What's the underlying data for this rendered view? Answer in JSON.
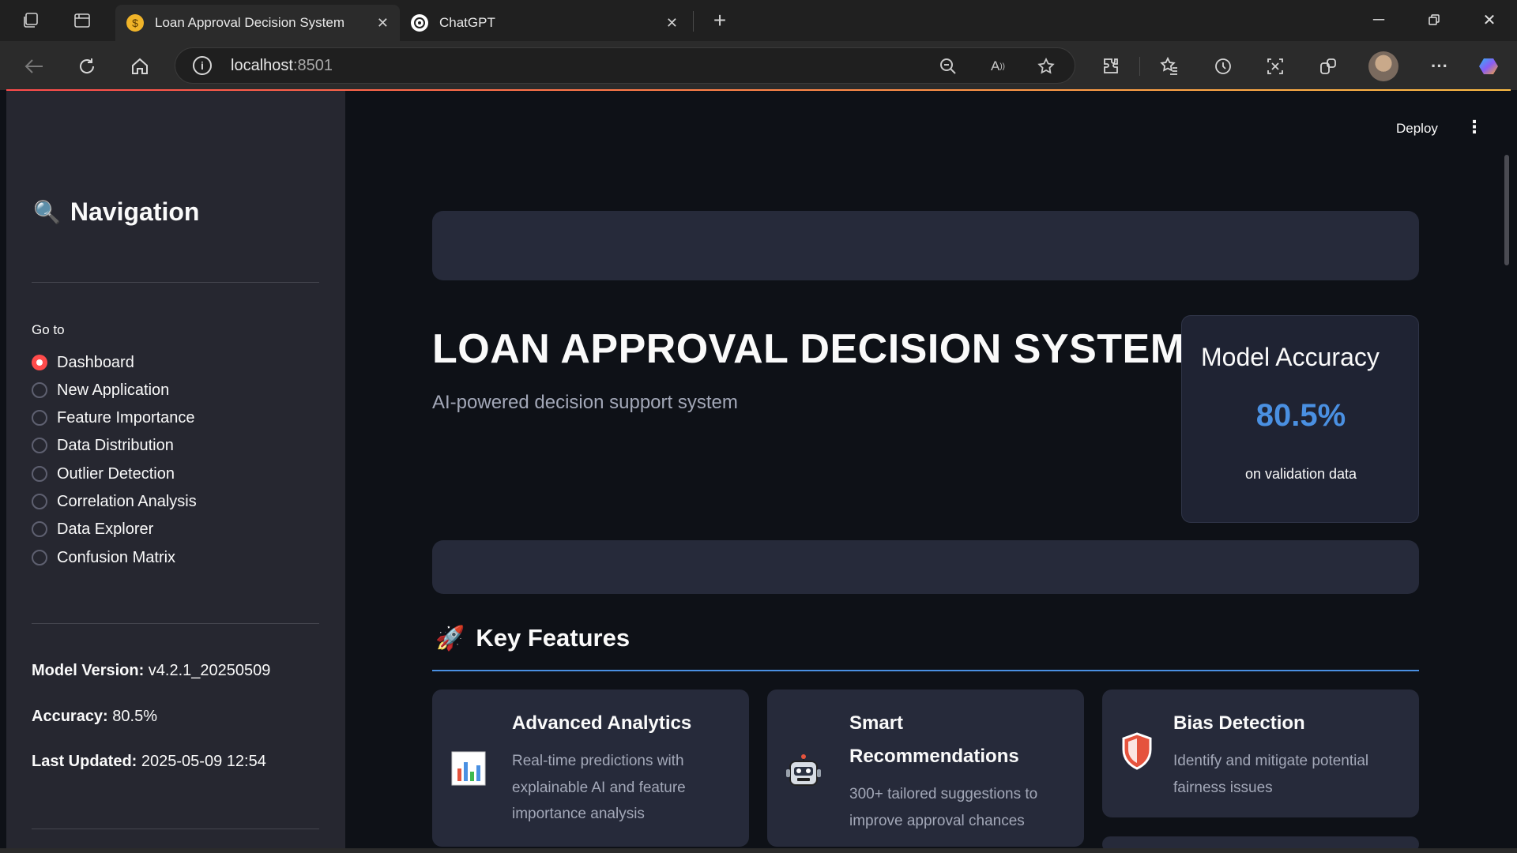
{
  "browser": {
    "tabs": [
      {
        "title": "Loan Approval Decision System",
        "favicon": "money-bag-icon",
        "active": true
      },
      {
        "title": "ChatGPT",
        "favicon": "chatgpt-icon",
        "active": false
      }
    ],
    "address": {
      "host": "localhost",
      "port": ":8501"
    }
  },
  "sidebar": {
    "title_icon": "🔍",
    "title": "Navigation",
    "goto_label": "Go to",
    "items": [
      {
        "label": "Dashboard",
        "selected": true
      },
      {
        "label": "New Application",
        "selected": false
      },
      {
        "label": "Feature Importance",
        "selected": false
      },
      {
        "label": "Data Distribution",
        "selected": false
      },
      {
        "label": "Outlier Detection",
        "selected": false
      },
      {
        "label": "Correlation Analysis",
        "selected": false
      },
      {
        "label": "Data Explorer",
        "selected": false
      },
      {
        "label": "Confusion Matrix",
        "selected": false
      }
    ],
    "meta": {
      "version_label": "Model Version:",
      "version_value": " v4.2.1_20250509",
      "accuracy_label": "Accuracy:",
      "accuracy_value": " 80.5%",
      "updated_label": "Last Updated:",
      "updated_value": " 2025-05-09 12:54"
    }
  },
  "header": {
    "deploy_label": "Deploy",
    "menu_icon": "⋮"
  },
  "hero": {
    "title": "LOAN APPROVAL DECISION SYSTEM",
    "subtitle": "AI-powered decision support system"
  },
  "accuracy_card": {
    "title": "Model Accuracy",
    "value": "80.5%",
    "caption": "on validation data"
  },
  "key_features": {
    "icon": "🚀",
    "title": "Key Features",
    "cards": [
      {
        "icon": "📊",
        "title_lines": [
          "Advanced Analytics"
        ],
        "desc_lines": [
          "Real-time predictions with",
          "explainable AI and feature",
          "importance analysis"
        ]
      },
      {
        "icon": "🤖",
        "title_lines": [
          "Smart",
          "Recommendations"
        ],
        "desc_lines": [
          "300+ tailored suggestions to",
          "improve approval chances"
        ]
      },
      {
        "icon": "🛡️",
        "title_lines": [
          "Bias Detection"
        ],
        "desc_lines": [
          "Identify and mitigate potential",
          "fairness issues"
        ]
      }
    ]
  },
  "colors": {
    "accent_red": "#ff4b4b",
    "accent_blue": "#4a90e2",
    "sidebar_bg": "#262730",
    "main_bg": "#0e1117"
  }
}
